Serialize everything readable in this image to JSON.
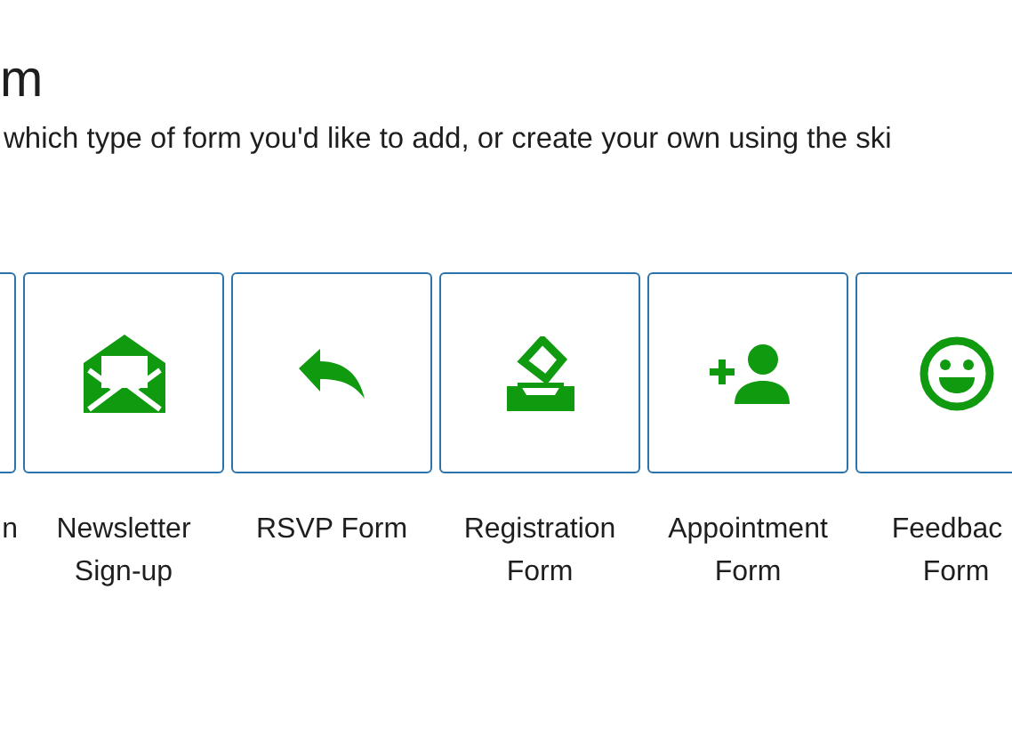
{
  "title": "m",
  "description": "which type of form you'd like to add, or create your own using the ski",
  "templates": [
    {
      "lines": [
        "n"
      ]
    },
    {
      "lines": [
        "Newsletter",
        "Sign-up"
      ]
    },
    {
      "lines": [
        "RSVP Form"
      ]
    },
    {
      "lines": [
        "Registration",
        "Form"
      ]
    },
    {
      "lines": [
        "Appointment",
        "Form"
      ]
    },
    {
      "lines": [
        "Feedbac",
        "Form"
      ]
    }
  ]
}
